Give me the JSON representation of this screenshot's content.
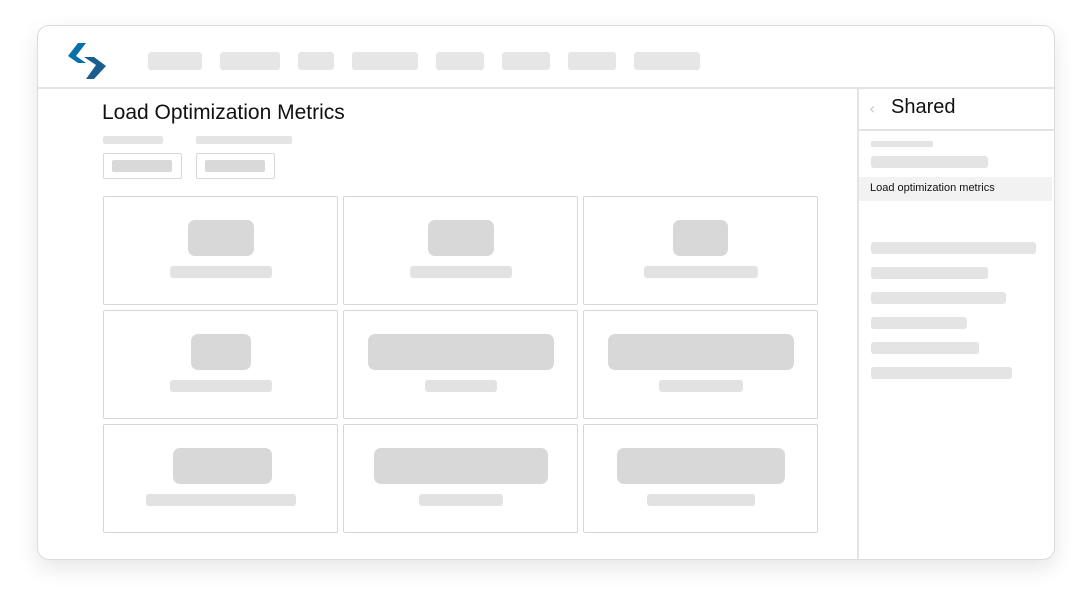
{
  "main": {
    "title": "Load Optimization Metrics"
  },
  "shared_panel": {
    "title": "Shared",
    "back_icon": "chevron-left-icon",
    "selected_item": "Load optimization metrics"
  },
  "branding": {
    "logo_icon": "lightning-logo-icon",
    "logo_colors": [
      "#0b6fa8",
      "#1b4f7a"
    ]
  }
}
